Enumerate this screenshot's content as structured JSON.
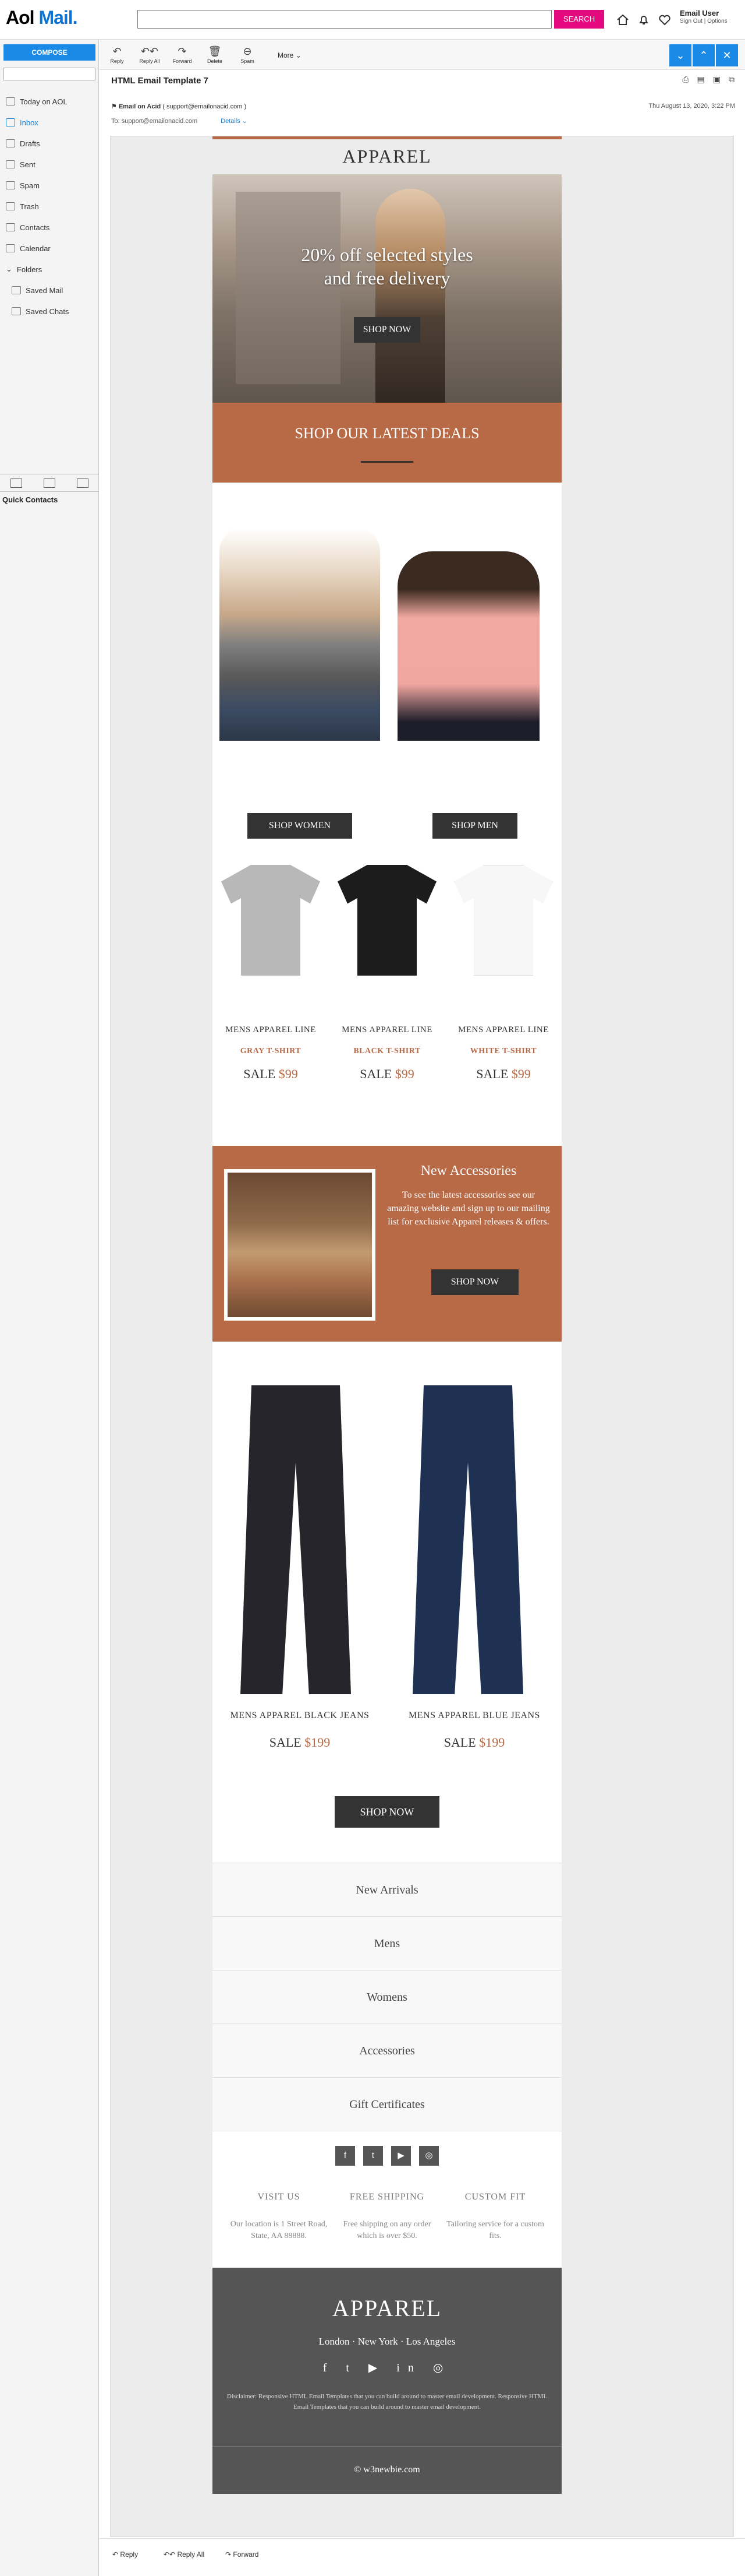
{
  "app": {
    "logo_text": "Aol",
    "logo_text2": "Mail."
  },
  "search": {
    "placeholder": "",
    "button": "SEARCH"
  },
  "user": {
    "name": "Email User",
    "sign_out": "Sign Out",
    "options": "Options"
  },
  "sidebar": {
    "compose": "COMPOSE",
    "items": [
      {
        "label": "Today on AOL"
      },
      {
        "label": "Inbox"
      },
      {
        "label": "Drafts"
      },
      {
        "label": "Sent"
      },
      {
        "label": "Spam"
      },
      {
        "label": "Trash"
      },
      {
        "label": "Contacts"
      },
      {
        "label": "Calendar"
      },
      {
        "label": "Folders"
      },
      {
        "label": "Saved Mail"
      },
      {
        "label": "Saved Chats"
      }
    ],
    "quick_contacts": "Quick Contacts"
  },
  "toolbar": {
    "reply": "Reply",
    "reply_all": "Reply All",
    "forward": "Forward",
    "delete": "Delete",
    "spam": "Spam",
    "more": "More"
  },
  "message": {
    "subject": "HTML Email Template 7",
    "from": "Email on Acid",
    "from_email": "( support@emailonacid.com )",
    "date": "Thu August 13, 2020, 3:22 PM",
    "to": "To: support@emailonacid.com",
    "details": "Details"
  },
  "email": {
    "brand": "APPAREL",
    "hero_line1": "20% off selected styles",
    "hero_line2": "and free delivery",
    "hero_button": "SHOP NOW",
    "deals_title": "SHOP OUR LATEST DEALS",
    "shop_women": "SHOP WOMEN",
    "shop_men": "SHOP MEN",
    "tees": [
      {
        "line": "MENS APPAREL LINE",
        "name": "GRAY T-SHIRT",
        "sale": "SALE",
        "price": "$99",
        "color": "#b8b8b8"
      },
      {
        "line": "MENS APPAREL LINE",
        "name": "BLACK T-SHIRT",
        "sale": "SALE",
        "price": "$99",
        "color": "#1c1c1c"
      },
      {
        "line": "MENS APPAREL LINE",
        "name": "WHITE T-SHIRT",
        "sale": "SALE",
        "price": "$99",
        "color": "#f7f7f7"
      }
    ],
    "accessories": {
      "title": "New Accessories",
      "text": "To see the latest accessories see our amazing website and sign up to our mailing list for exclusive Apparel releases & offers.",
      "button": "SHOP NOW"
    },
    "jeans": [
      {
        "name": "MENS APPAREL BLACK JEANS",
        "sale": "SALE",
        "price": "$199",
        "color": "#25252b"
      },
      {
        "name": "MENS APPAREL BLUE JEANS",
        "sale": "SALE",
        "price": "$199",
        "color": "#1f3152"
      }
    ],
    "jeans_button": "SHOP NOW",
    "menu": [
      "New Arrivals",
      "Mens",
      "Womens",
      "Accessories",
      "Gift Certificates"
    ],
    "social_icons": [
      "f",
      "t",
      "▶",
      "◎"
    ],
    "info": [
      {
        "title": "VISIT US",
        "desc": "Our location is 1 Street Road, State, AA 88888."
      },
      {
        "title": "FREE SHIPPING",
        "desc": "Free shipping on any order which is over $50."
      },
      {
        "title": "CUSTOM FIT",
        "desc": "Tailoring service for a custom fits."
      }
    ],
    "footer_brand": "APPAREL",
    "cities": "London · New York · Los Angeles",
    "footer_social": "f t ▶ in ◎",
    "disclaimer": "Disclaimer: Responsive HTML Email Templates that you can build around to master email development. Responsive HTML Email Templates that you can build around to master email development.",
    "copyright": "© w3newbie.com"
  },
  "bottom": {
    "reply": "Reply",
    "reply_all": "Reply All",
    "forward": "Forward"
  }
}
